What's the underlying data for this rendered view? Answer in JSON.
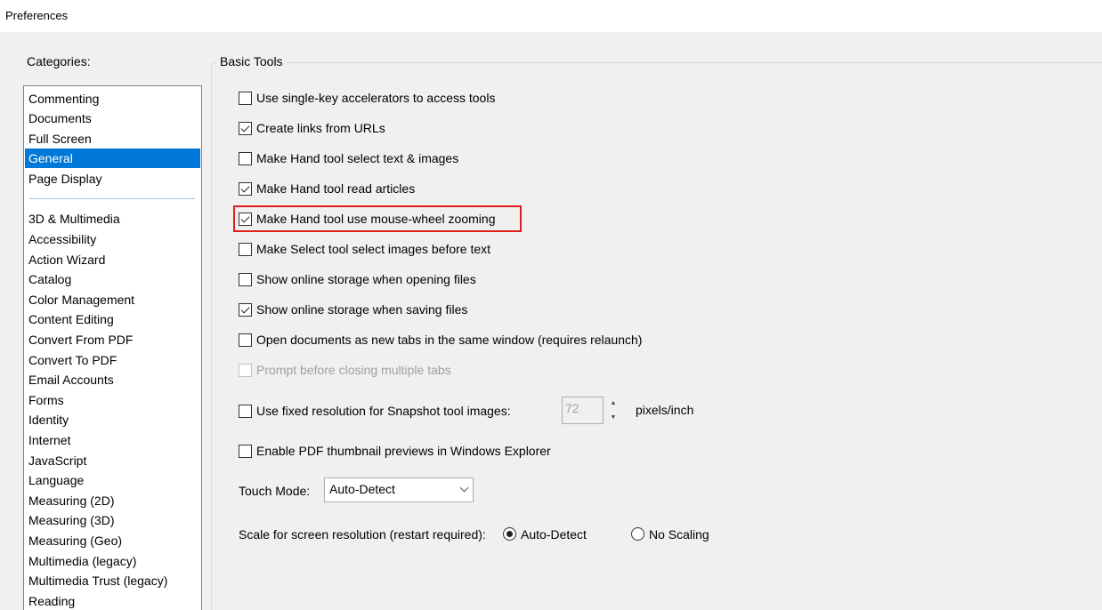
{
  "window": {
    "title": "Preferences"
  },
  "categories": {
    "label": "Categories:",
    "items": [
      "Commenting",
      "Documents",
      "Full Screen",
      "General",
      "Page Display",
      "3D & Multimedia",
      "Accessibility",
      "Action Wizard",
      "Catalog",
      "Color Management",
      "Content Editing",
      "Convert From PDF",
      "Convert To PDF",
      "Email Accounts",
      "Forms",
      "Identity",
      "Internet",
      "JavaScript",
      "Language",
      "Measuring (2D)",
      "Measuring (3D)",
      "Measuring (Geo)",
      "Multimedia (legacy)",
      "Multimedia Trust (legacy)",
      "Reading"
    ],
    "selected": "General"
  },
  "basic_tools": {
    "title": "Basic Tools",
    "options": [
      {
        "label": "Use single-key accelerators to access tools",
        "checked": false
      },
      {
        "label": "Create links from URLs",
        "checked": true
      },
      {
        "label": "Make Hand tool select text & images",
        "checked": false
      },
      {
        "label": "Make Hand tool read articles",
        "checked": true
      },
      {
        "label": "Make Hand tool use mouse-wheel zooming",
        "checked": true
      },
      {
        "label": "Make Select tool select images before text",
        "checked": false
      },
      {
        "label": "Show online storage when opening files",
        "checked": false
      },
      {
        "label": "Show online storage when saving files",
        "checked": true
      },
      {
        "label": "Open documents as new tabs in the same window (requires relaunch)",
        "checked": false
      },
      {
        "label": "Prompt before closing multiple tabs",
        "checked": false,
        "disabled": true
      }
    ],
    "snapshot": {
      "label": "Use fixed resolution for Snapshot tool images:",
      "checked": false,
      "value": "72",
      "units": "pixels/inch"
    },
    "thumbnail": {
      "label": "Enable PDF thumbnail previews in Windows Explorer",
      "checked": false
    },
    "touch_mode": {
      "label": "Touch Mode:",
      "value": "Auto-Detect"
    },
    "scale": {
      "label": "Scale for screen resolution (restart required):",
      "options": [
        "Auto-Detect",
        "No Scaling"
      ],
      "selected": "Auto-Detect"
    }
  },
  "colors": {
    "selection": "#0078d7",
    "highlight": "#e01e1e"
  }
}
